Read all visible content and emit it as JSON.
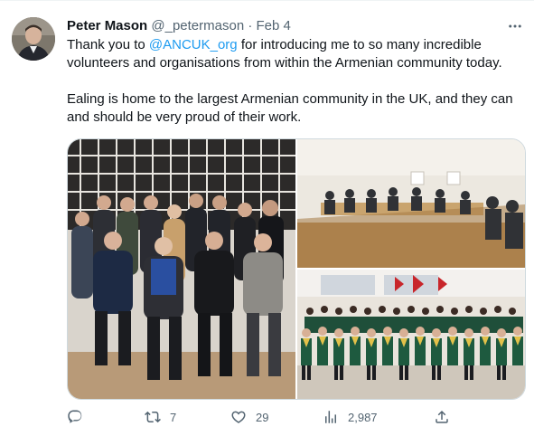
{
  "tweet": {
    "author_name": "Peter Mason",
    "handle": "@_petermason",
    "separator": "·",
    "date": "Feb 4",
    "text_before_mention": "Thank you to ",
    "mention": "@ANCUK_org",
    "text_after_mention": " for introducing me to so many incredible volunteers and organisations from within the Armenian community today.",
    "paragraph_2": "Ealing is home to the largest Armenian community in the UK, and they can and should be very proud of their work."
  },
  "media": {
    "photo_1": "group-photo-icon",
    "photo_2": "meeting-room-photo-icon",
    "photo_3": "scouts-group-photo-icon"
  },
  "actions": {
    "reply_count": "",
    "retweet_count": "7",
    "like_count": "29",
    "view_count": "2,987"
  },
  "colors": {
    "accent": "#1d9bf0",
    "muted": "#536471",
    "text": "#0f1419",
    "border": "#cfd9de"
  }
}
